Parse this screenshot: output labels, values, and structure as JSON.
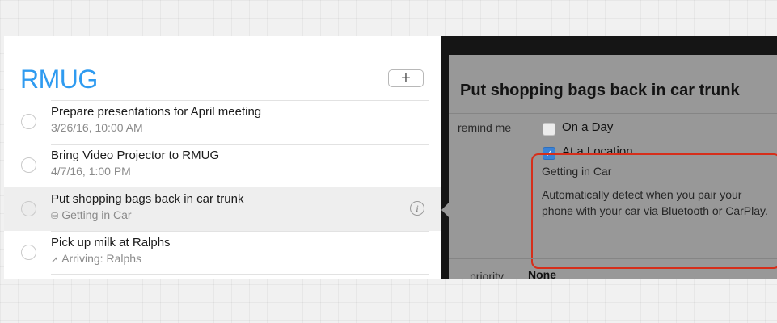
{
  "list": {
    "title": "RMUG",
    "add_label": "+",
    "items": [
      {
        "title": "Prepare presentations for April meeting",
        "subtitle": "3/26/16, 10:00 AM",
        "icon": ""
      },
      {
        "title": "Bring Video Projector to RMUG",
        "subtitle": "4/7/16, 1:00 PM",
        "icon": ""
      },
      {
        "title": "Put shopping bags back in car trunk",
        "subtitle": "Getting in Car",
        "icon": "car-icon"
      },
      {
        "title": "Pick up milk at Ralphs",
        "subtitle": "Arriving: Ralphs",
        "icon": "location-arrow-icon"
      }
    ],
    "selected_index": 2,
    "info_label": "i"
  },
  "detail": {
    "title": "Put shopping bags back in car trunk",
    "remind_label": "remind me",
    "on_day": {
      "label": "On a Day",
      "checked": false
    },
    "at_location": {
      "label": "At a Location",
      "checked": true
    },
    "location_name": "Getting in Car",
    "description": "Automatically detect when you pair your phone with your car via Bluetooth or CarPlay.",
    "priority_label": "priority",
    "priority_value": "None"
  },
  "colors": {
    "accent": "#2f9bf0",
    "highlight_border": "#d62e1a",
    "checkbox_on": "#3b82d6"
  }
}
